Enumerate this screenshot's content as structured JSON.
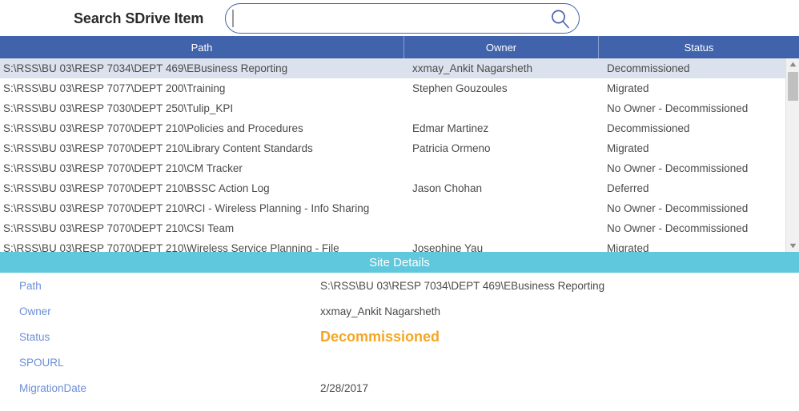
{
  "search": {
    "title": "Search SDrive Item",
    "value": "",
    "placeholder": "",
    "icon": "search-icon"
  },
  "table": {
    "columns": [
      "Path",
      "Owner",
      "Status"
    ],
    "rows": [
      {
        "path": "S:\\RSS\\BU 03\\RESP 7034\\DEPT 469\\EBusiness Reporting",
        "owner": "xxmay_Ankit Nagarsheth",
        "status": "Decommissioned",
        "selected": true
      },
      {
        "path": "S:\\RSS\\BU 03\\RESP 7077\\DEPT 200\\Training",
        "owner": "Stephen Gouzoules",
        "status": "Migrated",
        "selected": false
      },
      {
        "path": "S:\\RSS\\BU 03\\RESP 7030\\DEPT 250\\Tulip_KPI",
        "owner": "",
        "status": "No Owner - Decommissioned",
        "selected": false
      },
      {
        "path": "S:\\RSS\\BU 03\\RESP 7070\\DEPT 210\\Policies and Procedures",
        "owner": "Edmar Martinez",
        "status": "Decommissioned",
        "selected": false
      },
      {
        "path": "S:\\RSS\\BU 03\\RESP 7070\\DEPT 210\\Library Content Standards",
        "owner": "Patricia Ormeno",
        "status": "Migrated",
        "selected": false
      },
      {
        "path": "S:\\RSS\\BU 03\\RESP 7070\\DEPT 210\\CM Tracker",
        "owner": "",
        "status": "No Owner - Decommissioned",
        "selected": false
      },
      {
        "path": "S:\\RSS\\BU 03\\RESP 7070\\DEPT 210\\BSSC Action Log",
        "owner": "Jason Chohan",
        "status": "Deferred",
        "selected": false
      },
      {
        "path": "S:\\RSS\\BU 03\\RESP 7070\\DEPT 210\\RCI - Wireless Planning - Info Sharing",
        "owner": "",
        "status": "No Owner - Decommissioned",
        "selected": false
      },
      {
        "path": "S:\\RSS\\BU 03\\RESP 7070\\DEPT 210\\CSI Team",
        "owner": "",
        "status": "No Owner - Decommissioned",
        "selected": false
      },
      {
        "path": "S:\\RSS\\BU 03\\RESP 7070\\DEPT 210\\Wireless Service Planning - File",
        "owner": "Josephine Yau",
        "status": "Migrated",
        "selected": false
      }
    ]
  },
  "details": {
    "title": "Site Details",
    "fields": [
      {
        "label": "Path",
        "value": "S:\\RSS\\BU 03\\RESP 7034\\DEPT 469\\EBusiness Reporting"
      },
      {
        "label": "Owner",
        "value": "xxmay_Ankit Nagarsheth"
      },
      {
        "label": "Status",
        "value": "Decommissioned"
      },
      {
        "label": "SPOURL",
        "value": ""
      },
      {
        "label": "MigrationDate",
        "value": "2/28/2017"
      }
    ]
  },
  "colors": {
    "header_blue": "#4063ac",
    "details_teal": "#5fc8dc",
    "status_orange": "#f5a623",
    "selected_row": "#dce1ee",
    "label_blue": "#6b8ed6"
  }
}
